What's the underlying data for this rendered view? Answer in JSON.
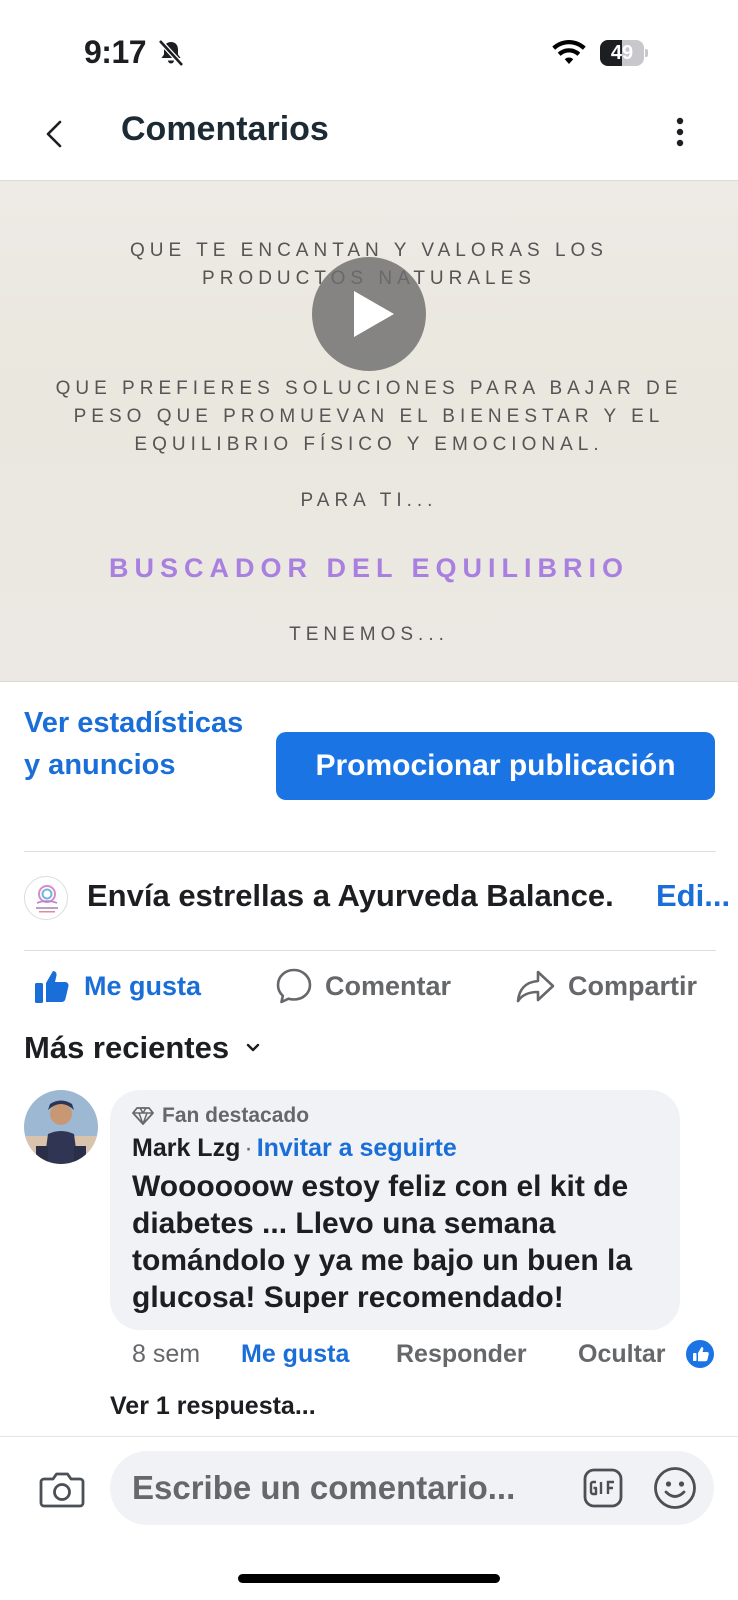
{
  "status_bar": {
    "time": "9:17",
    "battery": "49",
    "battery_level_percent": 49
  },
  "header": {
    "title": "Comentarios"
  },
  "video": {
    "line1": "QUE TE ENCANTAN Y VALORAS LOS PRODUCTOS NATURALES",
    "line2": "QUE PREFIERES SOLUCIONES PARA BAJAR DE PESO QUE PROMUEVAN EL BIENESTAR Y EL EQUILIBRIO FÍSICO Y EMOCIONAL.",
    "line3": "PARA TI...",
    "line4": "BUSCADOR DEL EQUILIBRIO",
    "line5": "TENEMOS...",
    "accent_color": "#a97fe0"
  },
  "post_actions": {
    "stats_label": "Ver estadísticas y anuncios",
    "promote_label": "Promocionar publicación"
  },
  "stars": {
    "text": "Envía estrellas a Ayurveda Balance.",
    "edit_label": "Edi..."
  },
  "reactions": {
    "like_label": "Me gusta",
    "comment_label": "Comentar",
    "share_label": "Compartir"
  },
  "sort": {
    "label": "Más recientes"
  },
  "comment": {
    "badge": "Fan destacado",
    "author": "Mark Lzg",
    "separator": "·",
    "invite_label": "Invitar a seguirte",
    "text": "Woooooow estoy feliz con el kit de diabetes ... Llevo una semana tomándolo y ya me bajo un buen la glucosa! Super recomendado!",
    "time": "8 sem",
    "like_label": "Me gusta",
    "reply_label": "Responder",
    "hide_label": "Ocultar",
    "view_replies": "Ver 1 respuesta..."
  },
  "composer": {
    "placeholder": "Escribe un comentario..."
  },
  "colors": {
    "link": "#1a6ed8",
    "button": "#1b74e4",
    "bubble": "#f0f2f5"
  }
}
